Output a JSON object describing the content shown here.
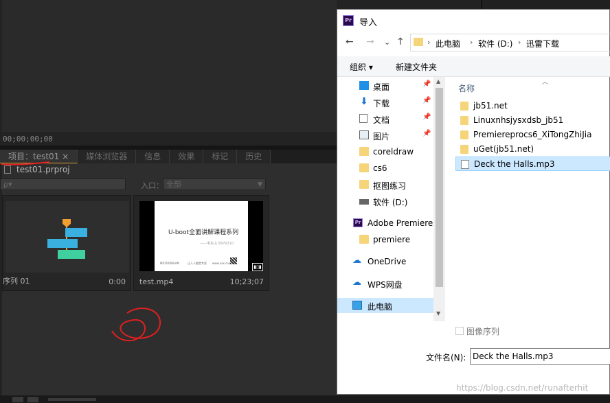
{
  "premiere": {
    "timecode": "00;00;00;00",
    "tabs": [
      {
        "label": "项目：test01 ×"
      },
      {
        "label": "媒体浏览器"
      },
      {
        "label": "信息"
      },
      {
        "label": "效果"
      },
      {
        "label": "标记"
      },
      {
        "label": "历史"
      }
    ],
    "project_file": "test01.prproj",
    "search_placeholder": "ρ▾",
    "entry_label": "入口：",
    "entry_value": "全部",
    "items": [
      {
        "name": "序列 01",
        "duration": "0:00"
      },
      {
        "name": "test.mp4",
        "duration": "10;23;07"
      }
    ],
    "slide": {
      "title": "U-boot全面讲解课程系列",
      "subtitle": "——韦东山 S5PV210",
      "footer1": "MICRODREAM",
      "footer2": "让人人都是专家",
      "footer3": "www.xxx.com"
    },
    "colors": {
      "accent": "#e0a030",
      "bg": "#2e2e2e"
    }
  },
  "dialog": {
    "title": "导入",
    "app_icon": "Pr",
    "nav": {
      "back": "←",
      "forward": "→",
      "recent": "⌄",
      "up": "↑"
    },
    "breadcrumb": [
      "此电脑",
      "软件 (D:)",
      "迅雷下载"
    ],
    "commands": {
      "organize": "组织 ▾",
      "new_folder": "新建文件夹"
    },
    "nav_pane": [
      {
        "label": "桌面",
        "icon": "desktop-icon",
        "pinned": true
      },
      {
        "label": "下载",
        "icon": "download-icon",
        "pinned": true
      },
      {
        "label": "文档",
        "icon": "document-icon",
        "pinned": true
      },
      {
        "label": "图片",
        "icon": "picture-icon",
        "pinned": true
      },
      {
        "label": "coreldraw",
        "icon": "folder-icon",
        "pinned": false
      },
      {
        "label": "cs6",
        "icon": "folder-icon",
        "pinned": false
      },
      {
        "label": "抠图练习",
        "icon": "folder-icon",
        "pinned": false
      },
      {
        "label": "软件 (D:)",
        "icon": "drive-icon",
        "pinned": false
      },
      {
        "label": "Adobe Premiere",
        "icon": "premiere-icon",
        "pinned": false
      },
      {
        "label": "premiere",
        "icon": "folder-icon",
        "pinned": false
      },
      {
        "label": "OneDrive",
        "icon": "onedrive-icon",
        "pinned": false
      },
      {
        "label": "WPS网盘",
        "icon": "wps-cloud-icon",
        "pinned": false
      },
      {
        "label": "此电脑",
        "icon": "this-pc-icon",
        "pinned": false
      }
    ],
    "pin_glyph": "📌",
    "column_header": "名称",
    "files": [
      {
        "name": "jb51.net",
        "type": "folder"
      },
      {
        "name": "Linuxnhsjysxdsb_jb51",
        "type": "folder"
      },
      {
        "name": "Premiereprocs6_XiTongZhiJia",
        "type": "folder"
      },
      {
        "name": "uGet(jb51.net)",
        "type": "folder"
      },
      {
        "name": "Deck the Halls.mp3",
        "type": "file"
      }
    ],
    "image_sequence_label": "图像序列",
    "filename_label": "文件名(N):",
    "filename_value": "Deck the Halls.mp3"
  },
  "watermark": "https://blog.csdn.net/runafterhit"
}
